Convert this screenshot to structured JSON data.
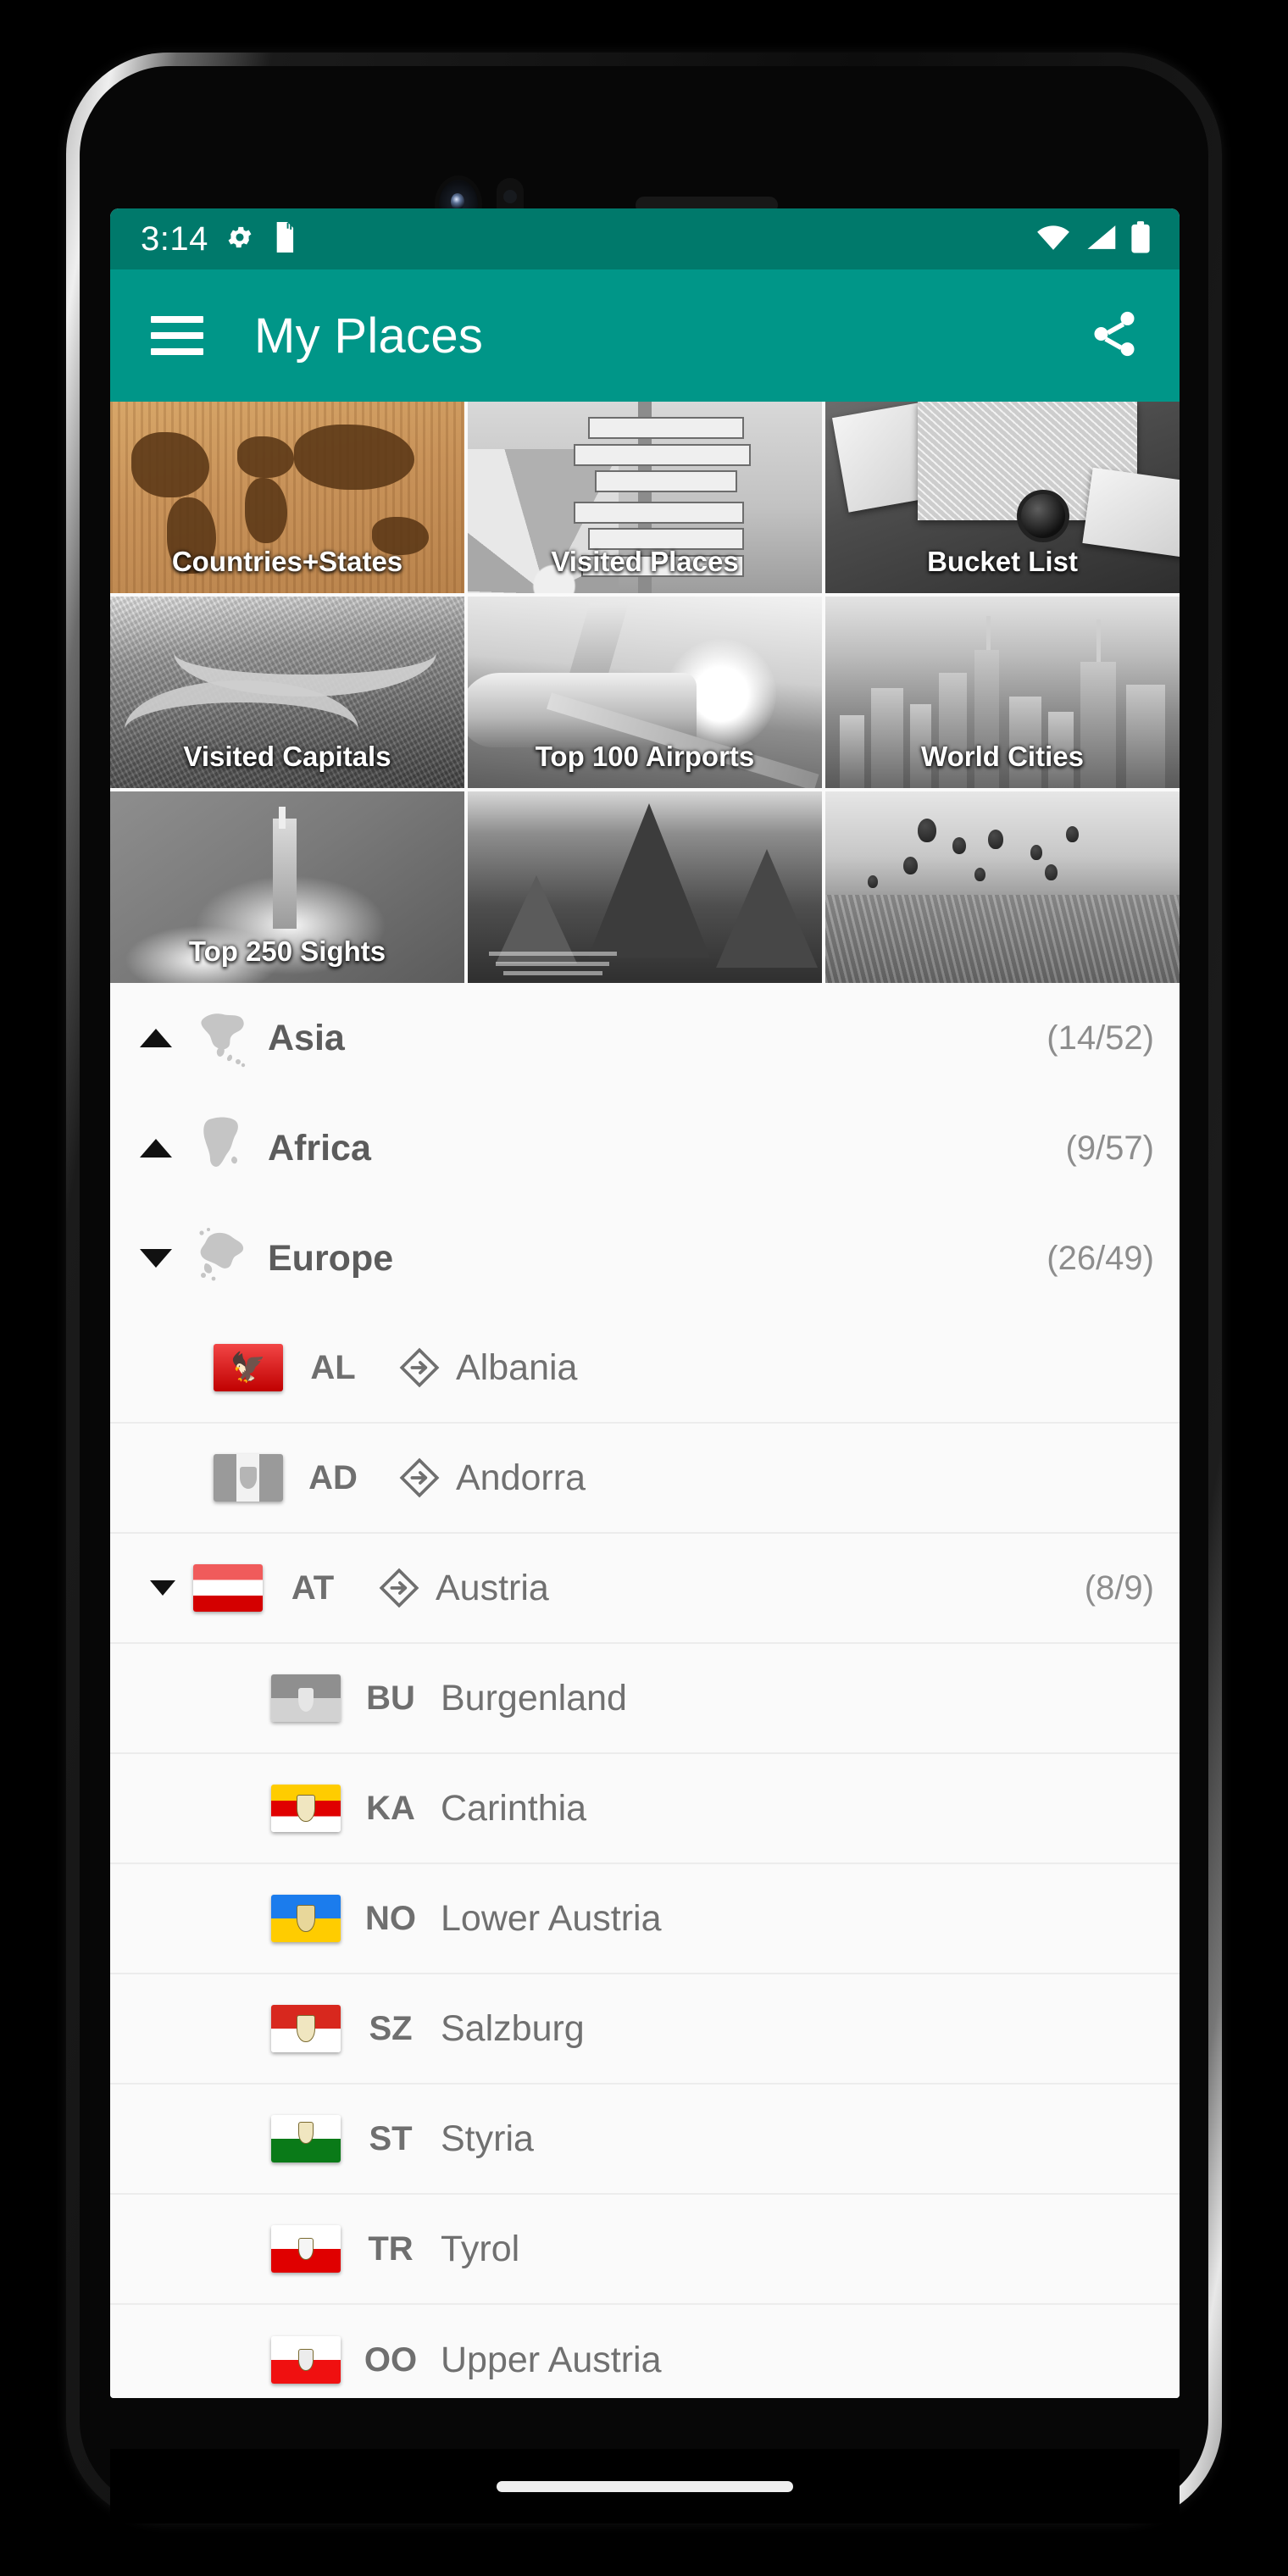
{
  "status_bar": {
    "time": "3:14",
    "icons_left": [
      "gear-icon",
      "sd-card-icon"
    ],
    "icons_right": [
      "wifi-icon",
      "cellular-signal-icon",
      "battery-icon"
    ],
    "background_color": "#00796b"
  },
  "app_bar": {
    "menu_icon": "hamburger-menu-icon",
    "title": "My Places",
    "share_icon": "share-icon",
    "background_color": "#009688"
  },
  "tiles": [
    {
      "label": "Countries+States",
      "art": "world-map-wood",
      "has_label": true
    },
    {
      "label": "Visited Places",
      "art": "signpost",
      "has_label": true
    },
    {
      "label": "Bucket List",
      "art": "map-camera",
      "has_label": true
    },
    {
      "label": "Visited Capitals",
      "art": "london-aerial",
      "has_label": true
    },
    {
      "label": "Top 100 Airports",
      "art": "airplane",
      "has_label": true
    },
    {
      "label": "World Cities",
      "art": "nyc-skyline",
      "has_label": true
    },
    {
      "label": "Top 250 Sights",
      "art": "statue-liberty",
      "has_label": true
    },
    {
      "label": "",
      "art": "machu-picchu",
      "has_label": false
    },
    {
      "label": "",
      "art": "hot-air-balloons",
      "has_label": false
    }
  ],
  "list": {
    "continents": [
      {
        "name": "Asia",
        "count": "(14/52)",
        "expanded": false,
        "caret": "up",
        "icon": "asia-map-icon"
      },
      {
        "name": "Africa",
        "count": "(9/57)",
        "expanded": false,
        "caret": "up",
        "icon": "africa-map-icon"
      },
      {
        "name": "Europe",
        "count": "(26/49)",
        "expanded": true,
        "caret": "down",
        "icon": "europe-map-icon"
      }
    ],
    "countries": [
      {
        "code": "AL",
        "name": "Albania",
        "count": "",
        "expandable": false,
        "caret": "none",
        "flag": "fl-albania",
        "visited": true,
        "goto_icon": "goto-arrow-icon"
      },
      {
        "code": "AD",
        "name": "Andorra",
        "count": "",
        "expandable": false,
        "caret": "none",
        "flag": "fl-andorra",
        "visited": false,
        "goto_icon": "goto-arrow-icon"
      },
      {
        "code": "AT",
        "name": "Austria",
        "count": "(8/9)",
        "expandable": true,
        "caret": "down",
        "flag": "fl-austria",
        "visited": true,
        "goto_icon": "goto-arrow-icon"
      }
    ],
    "states": [
      {
        "code": "BU",
        "name": "Burgenland",
        "flag": "fl-burgenland",
        "visited": false
      },
      {
        "code": "KA",
        "name": "Carinthia",
        "flag": "fl-carinthia",
        "visited": true
      },
      {
        "code": "NO",
        "name": "Lower Austria",
        "flag": "fl-lower",
        "visited": true
      },
      {
        "code": "SZ",
        "name": "Salzburg",
        "flag": "fl-salzburg",
        "visited": true
      },
      {
        "code": "ST",
        "name": "Styria",
        "flag": "fl-styria",
        "visited": true
      },
      {
        "code": "TR",
        "name": "Tyrol",
        "flag": "fl-tyrol",
        "visited": true
      },
      {
        "code": "OO",
        "name": "Upper Austria",
        "flag": "fl-upper",
        "visited": true
      }
    ]
  },
  "nav_bar": {
    "pill": "home-gesture-pill"
  }
}
